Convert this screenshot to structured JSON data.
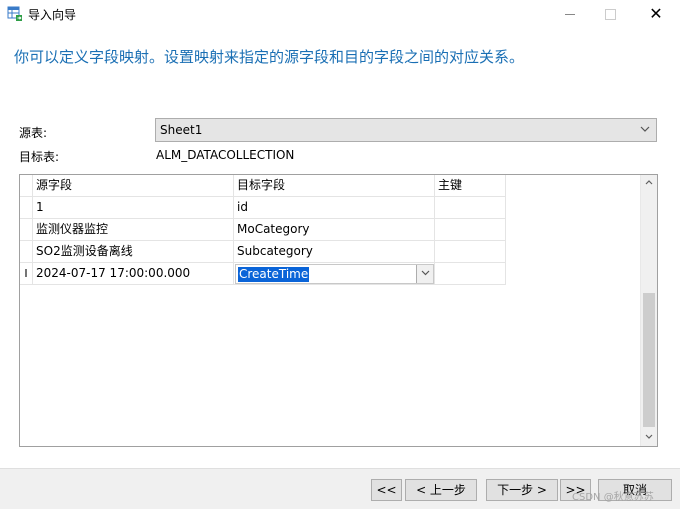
{
  "window": {
    "title": "导入向导"
  },
  "instruction": "你可以定义字段映射。设置映射来指定的源字段和目的字段之间的对应关系。",
  "form": {
    "source_label": "源表:",
    "source_value": "Sheet1",
    "target_label": "目标表:",
    "target_value": "ALM_DATACOLLECTION"
  },
  "grid": {
    "columns": [
      "源字段",
      "目标字段",
      "主键"
    ],
    "rows": [
      {
        "source": "1",
        "target": "id",
        "key": ""
      },
      {
        "source": "监测仪器监控",
        "target": "MoCategory",
        "key": ""
      },
      {
        "source": "SO2监测设备离线",
        "target": "Subcategory",
        "key": ""
      },
      {
        "source": "2024-07-17 17:00:00.000",
        "target": "CreateTime",
        "key": ""
      }
    ],
    "current_row_indicator": "I"
  },
  "buttons": {
    "first": "<<",
    "prev": "< 上一步",
    "next": "下一步 >",
    "last": ">>",
    "cancel": "取消"
  },
  "watermark": "CSDN @秋意苏苏",
  "icons": {
    "app": "table-import-icon",
    "combo_arrow": "chevron-down-icon",
    "scroll_up": "chevron-up-icon",
    "scroll_down": "chevron-down-icon"
  }
}
